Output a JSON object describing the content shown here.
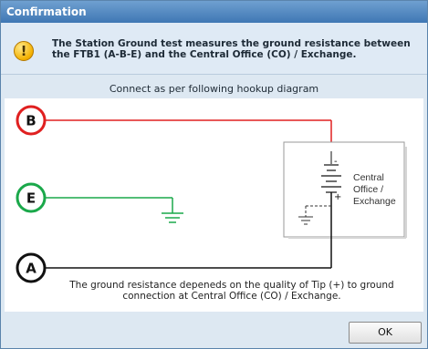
{
  "dialog": {
    "title": "Confirmation",
    "message": "The Station Ground test measures the ground resistance between the FTB1 (A-B-E) and the Central Office (CO) / Exchange.",
    "instruction": "Connect as per following hookup diagram",
    "ok_label": "OK"
  },
  "diagram": {
    "terminals": [
      {
        "label": "B",
        "color": "#e02020"
      },
      {
        "label": "E",
        "color": "#1aa84a"
      },
      {
        "label": "A",
        "color": "#111111"
      }
    ],
    "co_label_line1": "Central",
    "co_label_line2": "Office /",
    "co_label_line3": "Exchange",
    "battery_minus": "-",
    "battery_plus": "+",
    "note": "The ground resistance depeneds on the quality of Tip (+) to ground connection at Central Office (CO) / Exchange."
  },
  "colors": {
    "titlebar": "#3f77b4",
    "b_wire": "#e02020",
    "e_wire": "#1aa84a",
    "a_wire": "#111111",
    "warning": "#f3b000"
  },
  "icons": {
    "warning": "warning-icon",
    "ground": "ground-symbol-icon",
    "battery": "battery-icon"
  }
}
